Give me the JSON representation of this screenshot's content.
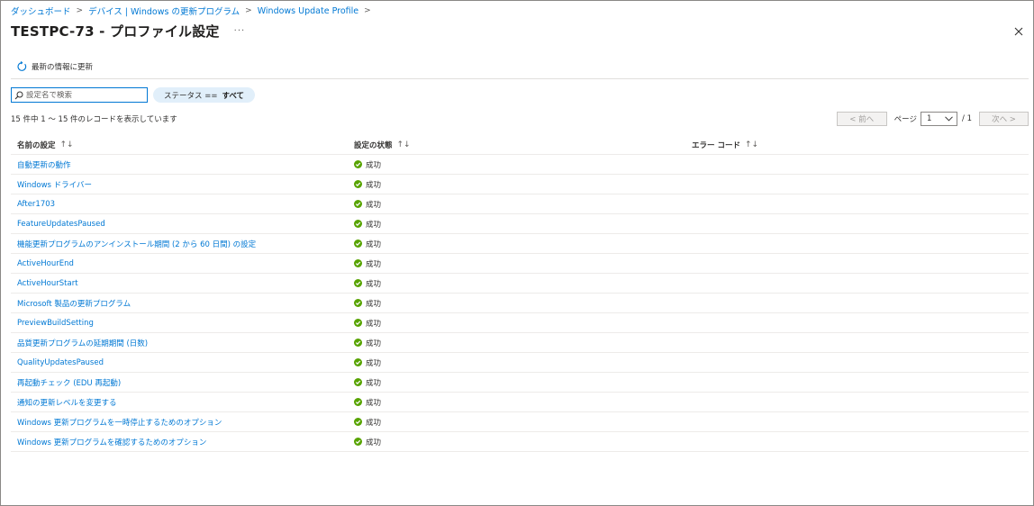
{
  "breadcrumb": [
    {
      "label": "ダッシュボード"
    },
    {
      "label": "デバイス | Windows の更新プログラム"
    },
    {
      "label": "Windows Update Profile"
    }
  ],
  "breadcrumb_separator": ">",
  "page": {
    "title": "TESTPC-73 - プロファイル設定",
    "more": "···"
  },
  "toolbar": {
    "refresh_label": "最新の情報に更新"
  },
  "search": {
    "placeholder": "設定名で検索",
    "value": ""
  },
  "filter": {
    "key": "ステータス ==",
    "value": "すべて"
  },
  "record_count": "15 件中 1 ～ 15 件のレコードを表示しています",
  "pager": {
    "prev_label": "< 前へ",
    "page_label": "ページ",
    "current_page": "1",
    "total": "/ 1",
    "next_label": "次へ >"
  },
  "columns": {
    "name": "名前の設定",
    "status": "設定の状態",
    "error": "エラー コード",
    "sort_glyph": "↑↓"
  },
  "rows": [
    {
      "name": "自動更新の動作",
      "status": "成功",
      "error": ""
    },
    {
      "name": "Windows ドライバー",
      "status": "成功",
      "error": ""
    },
    {
      "name": "After1703",
      "status": "成功",
      "error": ""
    },
    {
      "name": "FeatureUpdatesPaused",
      "status": "成功",
      "error": ""
    },
    {
      "name": "機能更新プログラムのアンインストール期間 (2 から 60 日間) の設定",
      "status": "成功",
      "error": ""
    },
    {
      "name": "ActiveHourEnd",
      "status": "成功",
      "error": ""
    },
    {
      "name": "ActiveHourStart",
      "status": "成功",
      "error": ""
    },
    {
      "name": "Microsoft 製品の更新プログラム",
      "status": "成功",
      "error": ""
    },
    {
      "name": "PreviewBuildSetting",
      "status": "成功",
      "error": ""
    },
    {
      "name": "品質更新プログラムの延期期間 (日数)",
      "status": "成功",
      "error": ""
    },
    {
      "name": "QualityUpdatesPaused",
      "status": "成功",
      "error": ""
    },
    {
      "name": "再起動チェック (EDU 再起動)",
      "status": "成功",
      "error": ""
    },
    {
      "name": "通知の更新レベルを変更する",
      "status": "成功",
      "error": ""
    },
    {
      "name": "Windows 更新プログラムを一時停止するためのオプション",
      "status": "成功",
      "error": ""
    },
    {
      "name": "Windows 更新プログラムを確認するためのオプション",
      "status": "成功",
      "error": ""
    }
  ],
  "colors": {
    "link": "#0078d4",
    "success": "#57a300",
    "filter_bg": "#e1effa"
  },
  "icons": {
    "refresh": "refresh-icon",
    "search": "search-icon",
    "close": "close-icon",
    "status": "success-check-icon",
    "dropdown": "chevron-down-icon"
  }
}
